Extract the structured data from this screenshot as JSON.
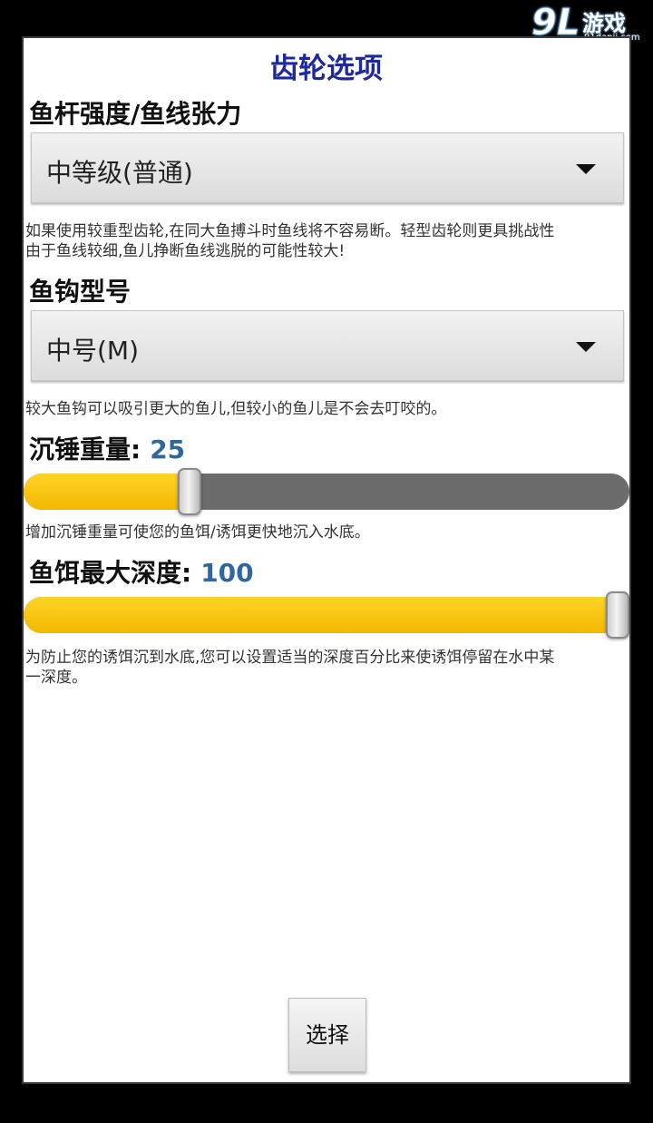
{
  "dialog": {
    "title": "齿轮选项",
    "rod": {
      "label": "鱼杆强度/鱼线张力",
      "selected": "中等级(普通)",
      "description_line1": "如果使用较重型齿轮,在同大鱼搏斗时鱼线将不容易断。轻型齿轮则更具挑战性",
      "description_line2": "由于鱼线较细,鱼儿挣断鱼线逃脱的可能性较大!"
    },
    "hook": {
      "label": "鱼钩型号",
      "selected": "中号(M)",
      "description": "较大鱼钩可以吸引更大的鱼儿,但较小的鱼儿是不会去叮咬的。"
    },
    "sinker": {
      "label": "沉锤重量:",
      "value": "25",
      "level_fraction": 0.265,
      "description": "增加沉锤重量可使您的鱼饵/诱饵更快地沉入水底。"
    },
    "depth": {
      "label": "鱼饵最大深度:",
      "value": "100",
      "level_fraction": 1.0,
      "description_line1": "为防止您的诱饵沉到水底,您可以设置适当的深度百分比来使诱饵停留在水中某",
      "description_line2": "一深度。"
    },
    "select_button": "选择"
  },
  "watermark": {
    "logo": "9L",
    "name": "游戏",
    "domain": "91danji.com"
  },
  "colors": {
    "title": "#1f2a9a",
    "value": "#2f66a0",
    "slider_fill": "#ffd428",
    "slider_track": "#6c6c6c"
  }
}
